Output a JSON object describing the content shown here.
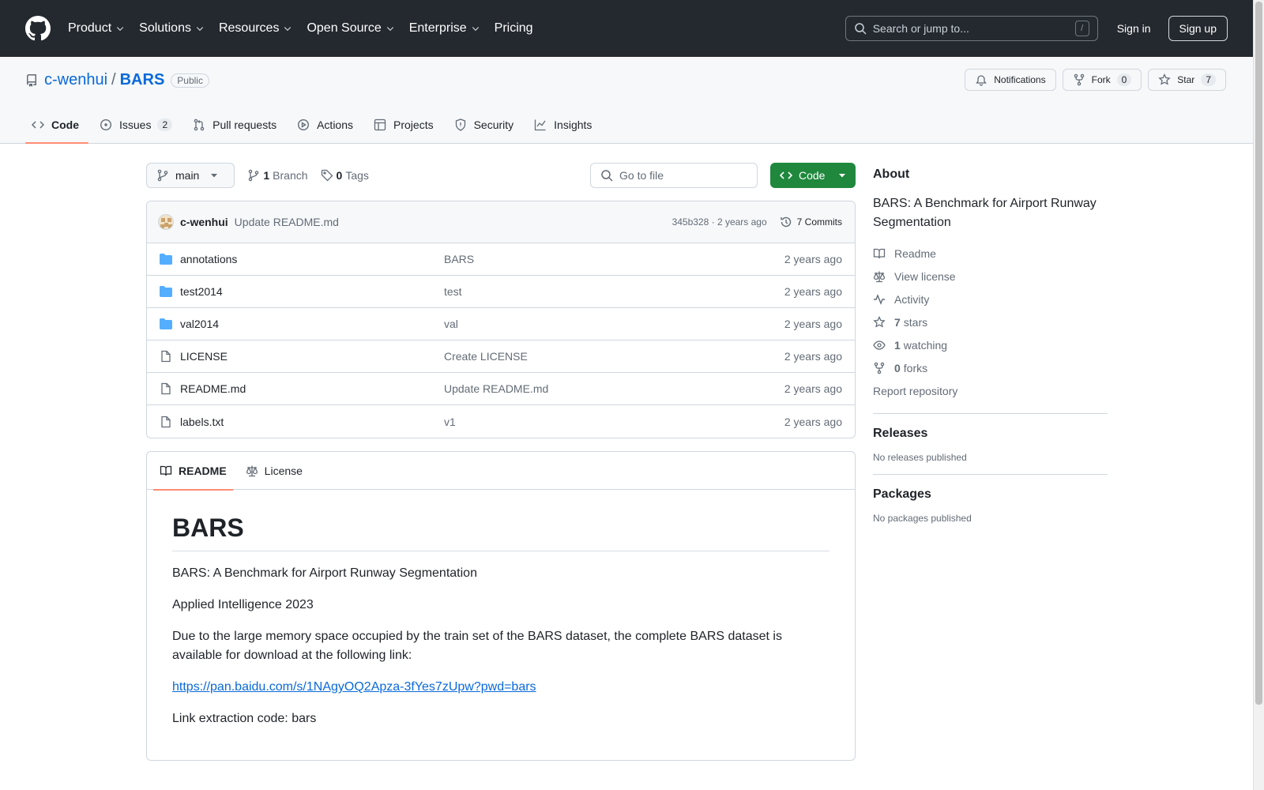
{
  "header": {
    "nav": [
      "Product",
      "Solutions",
      "Resources",
      "Open Source",
      "Enterprise",
      "Pricing"
    ],
    "search_placeholder": "Search or jump to...",
    "search_shortcut": "/",
    "sign_in": "Sign in",
    "sign_up": "Sign up"
  },
  "repo": {
    "owner": "c-wenhui",
    "separator": "/",
    "name": "BARS",
    "visibility": "Public",
    "notifications": "Notifications",
    "fork_label": "Fork",
    "fork_count": "0",
    "star_label": "Star",
    "star_count": "7",
    "tabs": [
      {
        "label": "Code"
      },
      {
        "label": "Issues",
        "count": "2"
      },
      {
        "label": "Pull requests"
      },
      {
        "label": "Actions"
      },
      {
        "label": "Projects"
      },
      {
        "label": "Security"
      },
      {
        "label": "Insights"
      }
    ]
  },
  "toolbar": {
    "branch": "main",
    "branch_count": "1",
    "branch_label": "Branch",
    "tag_count": "0",
    "tag_label": "Tags",
    "goto_file": "Go to file",
    "code_button": "Code"
  },
  "commit": {
    "author": "c-wenhui",
    "message": "Update README.md",
    "meta": "345b328 · 2 years ago",
    "commits": "7 Commits"
  },
  "files": [
    {
      "name": "annotations",
      "type": "folder",
      "message": "BARS",
      "date": "2 years ago"
    },
    {
      "name": "test2014",
      "type": "folder",
      "message": "test",
      "date": "2 years ago"
    },
    {
      "name": "val2014",
      "type": "folder",
      "message": "val",
      "date": "2 years ago"
    },
    {
      "name": "LICENSE",
      "type": "file",
      "message": "Create LICENSE",
      "date": "2 years ago"
    },
    {
      "name": "README.md",
      "type": "file",
      "message": "Update README.md",
      "date": "2 years ago"
    },
    {
      "name": "labels.txt",
      "type": "file",
      "message": "v1",
      "date": "2 years ago"
    }
  ],
  "readme": {
    "tab_readme": "README",
    "tab_license": "License",
    "title": "BARS",
    "p1": "BARS: A Benchmark for Airport Runway Segmentation",
    "p2": "Applied Intelligence 2023",
    "p3": "Due to the large memory space occupied by the train set of the BARS dataset, the complete BARS dataset is available for download at the following link:",
    "link": "https://pan.baidu.com/s/1NAgyOQ2Apza-3fYes7zUpw?pwd=bars",
    "p4": "Link extraction code: bars"
  },
  "about": {
    "heading": "About",
    "description": "BARS: A Benchmark for Airport Runway Segmentation",
    "readme": "Readme",
    "license": "View license",
    "activity": "Activity",
    "stars_count": "7",
    "stars_label": "stars",
    "watching_count": "1",
    "watching_label": "watching",
    "forks_count": "0",
    "forks_label": "forks",
    "report": "Report repository"
  },
  "releases": {
    "heading": "Releases",
    "empty": "No releases published"
  },
  "packages": {
    "heading": "Packages",
    "empty": "No packages published"
  },
  "colors": {
    "header_bg": "#24292f",
    "link": "#0969da",
    "code_button": "#1f883d",
    "tab_underline": "#fd8c73",
    "folder": "#54aeff"
  }
}
